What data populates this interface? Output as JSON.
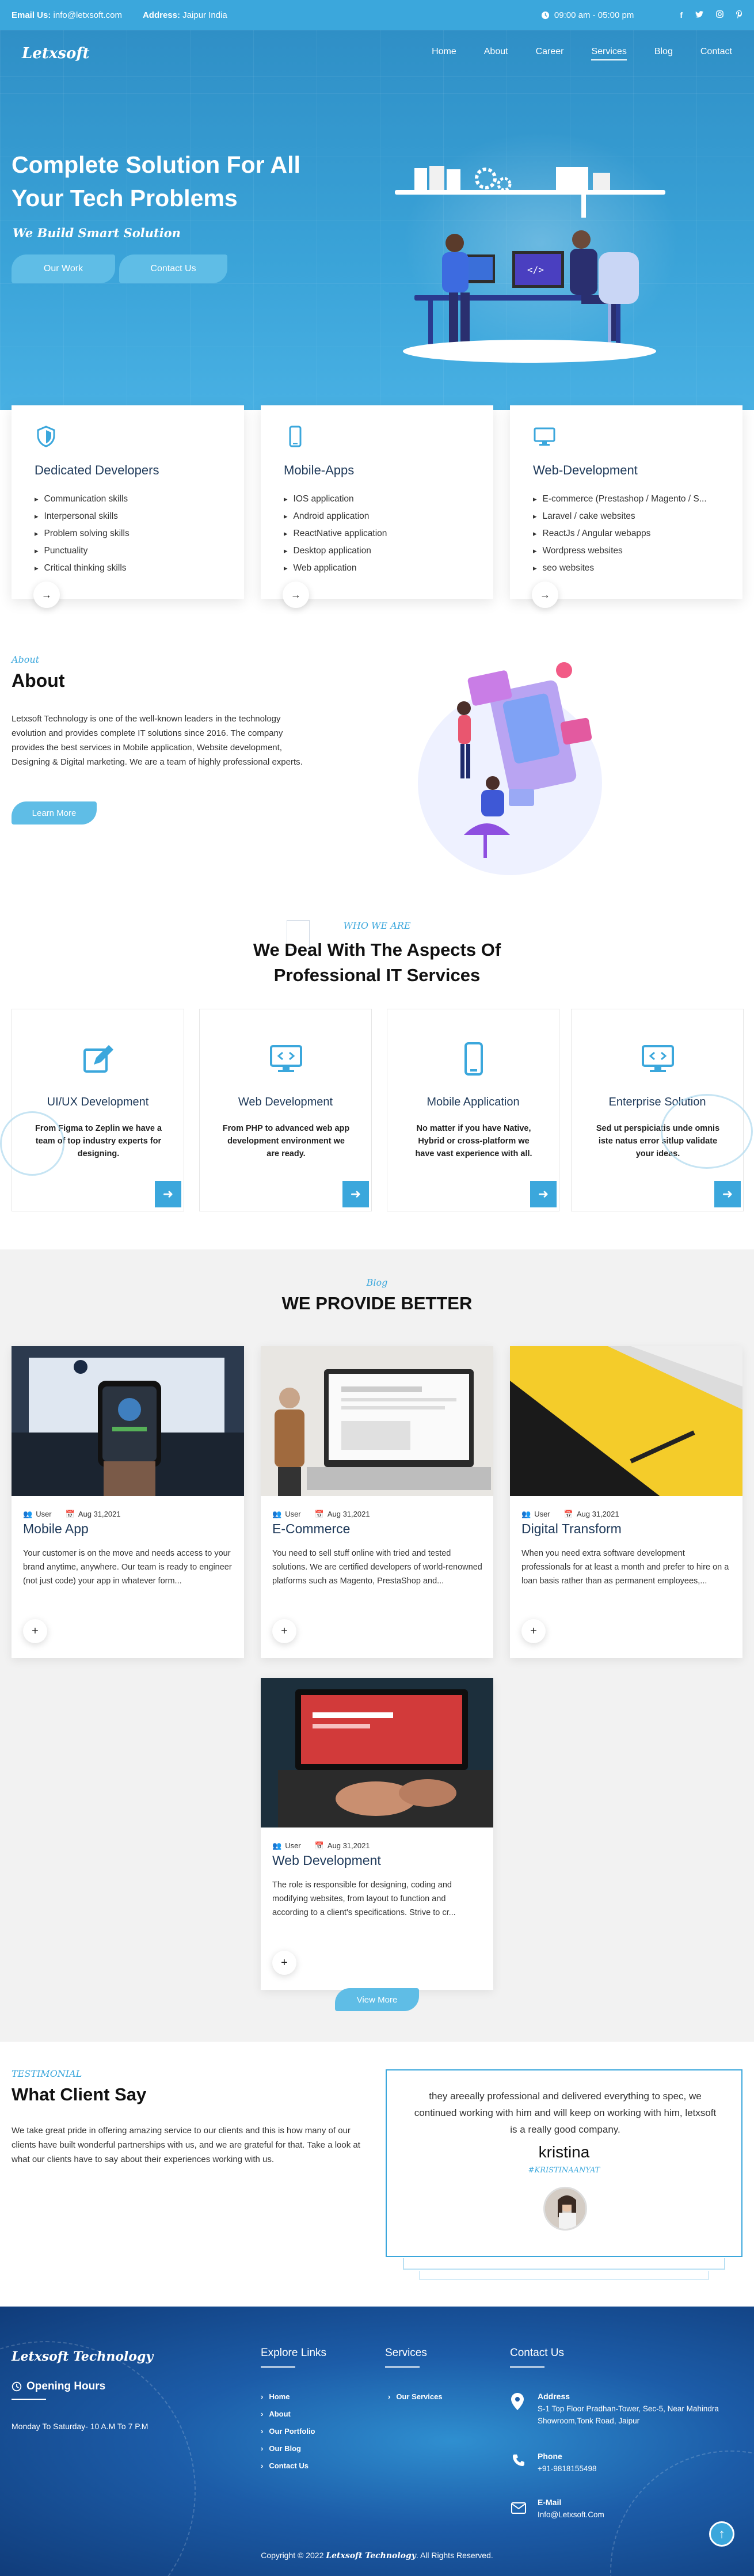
{
  "topbar": {
    "email_label": "Email Us:",
    "email": "info@letxsoft.com",
    "address_label": "Address:",
    "address": "Jaipur India",
    "hours": "09:00 am - 05:00 pm",
    "social": [
      "f",
      "t",
      "ig",
      "p"
    ]
  },
  "nav": {
    "logo": "Letxsoft",
    "items": [
      "Home",
      "About",
      "Career",
      "Services",
      "Blog",
      "Contact"
    ]
  },
  "hero": {
    "title": "Complete Solution For All Your Tech Problems",
    "tagline": "We Build Smart Solution",
    "btn_work": "Our Work",
    "btn_contact": "Contact Us"
  },
  "services": [
    {
      "icon": "shield-icon",
      "title": "Dedicated Developers",
      "items": [
        "Communication skills",
        "Interpersonal skills",
        "Problem solving skills",
        "Punctuality",
        "Critical thinking skills"
      ]
    },
    {
      "icon": "mobile-icon",
      "title": "Mobile-Apps",
      "items": [
        "IOS application",
        "Android application",
        "ReactNative application",
        "Desktop application",
        "Web application"
      ]
    },
    {
      "icon": "monitor-icon",
      "title": "Web-Development",
      "items": [
        "E-commerce (Prestashop / Magento / S...",
        "Laravel / cake websites",
        "ReactJs / Angular webapps",
        "Wordpress websites",
        "seo websites"
      ]
    }
  ],
  "about": {
    "eyebrow": "About",
    "title": "About",
    "text": "Letxsoft Technology is one of the well-known leaders in the technology evolution and provides complete IT solutions since 2016. The company provides the best services in Mobile application, Website development, Designing & Digital marketing. We are a team of highly professional experts.",
    "button": "Learn More"
  },
  "aspects": {
    "eyebrow": "WHO WE ARE",
    "title": "We Deal With The Aspects Of Professional IT Services",
    "cards": [
      {
        "icon": "pencil-icon",
        "title": "UI/UX Development",
        "text": "From Figma to Zeplin we have a team of top industry experts for designing."
      },
      {
        "icon": "code-monitor-icon",
        "title": "Web Development",
        "text": "From PHP to advanced web app development environment we are ready."
      },
      {
        "icon": "mobile-icon",
        "title": "Mobile Application",
        "text": "No matter if you have Native, Hybrid or cross-platform we have vast experience with all."
      },
      {
        "icon": "code-monitor-icon",
        "title": "Enterprise Solution",
        "text": "Sed ut perspiciatis unde omnis iste natus error sitlup validate your ideas."
      }
    ]
  },
  "blog": {
    "eyebrow": "Blog",
    "title": "WE PROVIDE BETTER",
    "posts": [
      {
        "author": "User",
        "date": "Aug 31,2021",
        "title": "Mobile App",
        "excerpt": "Your customer is on the move and needs access to your brand anytime, anywhere. Our team is ready to engineer (not just code) your app in whatever form..."
      },
      {
        "author": "User",
        "date": "Aug 31,2021",
        "title": "E-Commerce",
        "excerpt": "You need to sell stuff online with tried and tested solutions. We are certified developers of world-renowned platforms such as Magento, PrestaShop and..."
      },
      {
        "author": "User",
        "date": "Aug 31,2021",
        "title": "Digital Transform",
        "excerpt": "When you need extra software development professionals for at least a month and prefer to hire on a loan basis rather than as permanent employees,..."
      },
      {
        "author": "User",
        "date": "Aug 31,2021",
        "title": "Web Development",
        "excerpt": "The role is responsible for designing, coding and modifying websites, from layout to function and according to a client's specifications. Strive to cr..."
      }
    ],
    "view_more": "View More"
  },
  "testimonial": {
    "eyebrow": "TESTIMONIAL",
    "title": "What Client Say",
    "text": "We take great pride in offering amazing service to our clients and this is how many of our clients have built wonderful partnerships with us, and we are grateful for that. Take a look at what our clients have to say about their experiences working with us.",
    "quote": "they areeally professional and delivered everything to spec, we continued working with him and will keep on working with him, letxsoft is a really good company.",
    "name": "kristina",
    "handle": "#KRISTINAANYAT"
  },
  "footer": {
    "logo": "Letxsoft Technology",
    "hours_title": "Opening Hours",
    "hours": "Monday To Saturday- 10 A.M To 7 P.M",
    "explore_title": "Explore Links",
    "explore": [
      "Home",
      "About",
      "Our Portfolio",
      "Our Blog",
      "Contact Us"
    ],
    "services_title": "Services",
    "services": [
      "Our Services"
    ],
    "contact_title": "Contact Us",
    "address_label": "Address",
    "address": "S-1 Top Floor Pradhan-Tower, Sec-5, Near Mahindra Showroom,Tonk Road, Jaipur",
    "phone_label": "Phone",
    "phone": "+91-9818155498",
    "email_label": "E-Mail",
    "email": "Info@Letxsoft.Com",
    "copyright_pre": "Copyright © 2022",
    "copyright_brand": "Letxsoft Technology",
    "copyright_post": ". All Rights Reserved."
  },
  "colors": {
    "accent": "#3ba7dc",
    "heading": "#1f3a5a",
    "footer": "#1c5ca8"
  }
}
